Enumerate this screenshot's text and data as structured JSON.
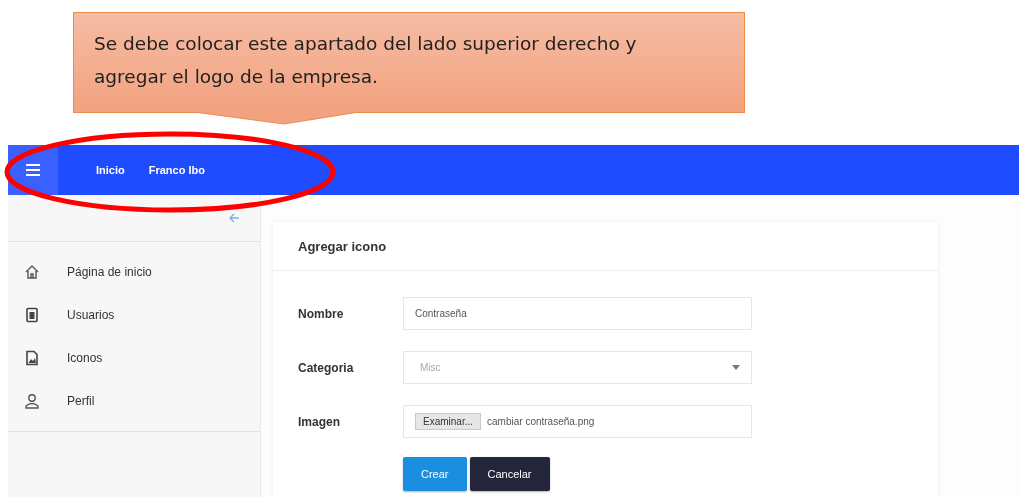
{
  "annotation": {
    "text": "Se debe colocar este apartado del lado superior derecho y agregar el logo de la empresa."
  },
  "navbar": {
    "links": [
      {
        "label": "Inicio"
      },
      {
        "label": "Franco Ibo"
      }
    ]
  },
  "sidebar": {
    "items": [
      {
        "label": "Página de inicio",
        "kind": "home"
      },
      {
        "label": "Usuarios",
        "kind": "badge"
      },
      {
        "label": "Iconos",
        "kind": "image"
      },
      {
        "label": "Perfil",
        "kind": "user"
      }
    ]
  },
  "card": {
    "title": "Agregar icono",
    "fields": [
      {
        "kind": "text",
        "label": "Nombre",
        "value": "Contraseña"
      },
      {
        "kind": "select",
        "label": "Categoria",
        "placeholder": "Misc"
      },
      {
        "kind": "file",
        "label": "Imagen",
        "button": "Examinar...",
        "value": "cambiar contraseña.png"
      }
    ],
    "buttons": [
      {
        "label": "Crear",
        "kind": "primary"
      },
      {
        "label": "Cancelar",
        "kind": "dark"
      }
    ]
  }
}
